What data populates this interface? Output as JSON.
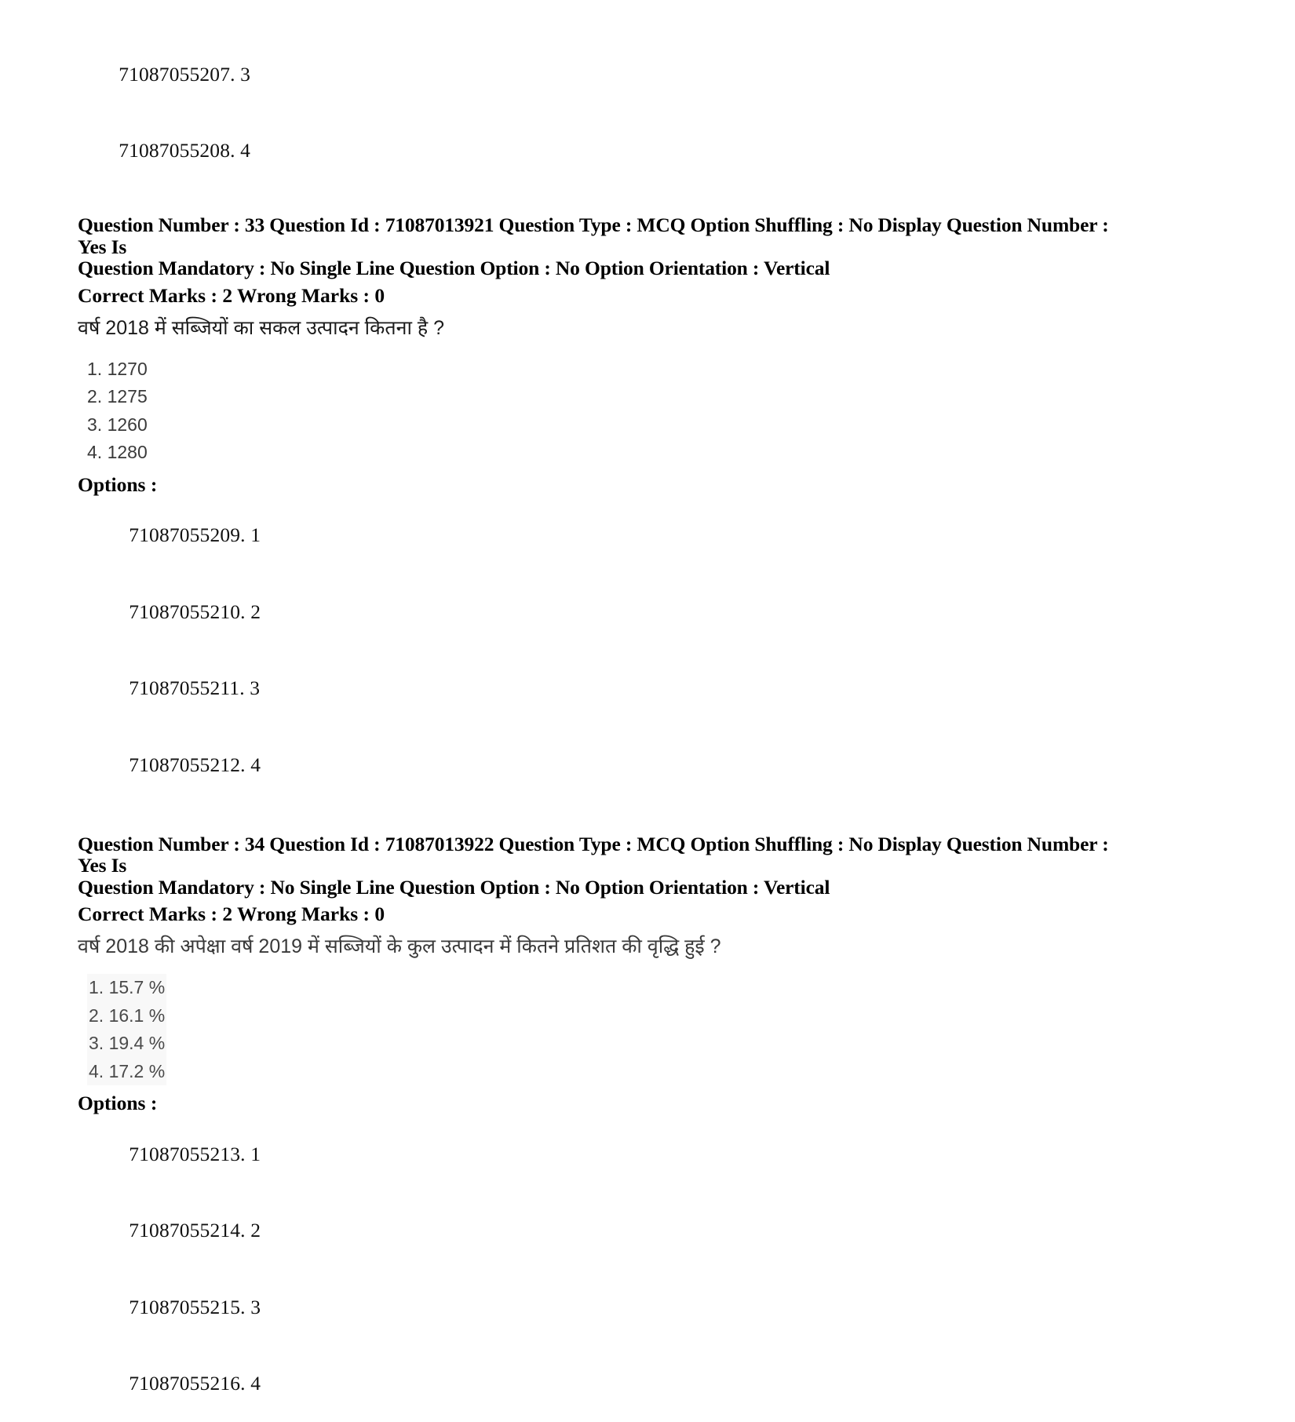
{
  "document": {
    "type": "exam-answer-key-page",
    "language_primary": "English",
    "language_question": "Hindi"
  },
  "top_option_ids": [
    {
      "id": "71087055207",
      "value": "3"
    },
    {
      "id": "71087055208",
      "value": "4"
    }
  ],
  "questions": [
    {
      "header_line_1": "Question Number : 33 Question Id : 71087013921 Question Type : MCQ Option Shuffling : No Display Question Number : Yes Is",
      "header_line_2": "Question Mandatory : No Single Line Question Option : No Option Orientation : Vertical",
      "marks_line": "Correct Marks : 2 Wrong Marks : 0",
      "question_number": "33",
      "question_id": "71087013921",
      "question_type": "MCQ",
      "option_shuffling": "No",
      "display_question_number": "Yes",
      "is_question_mandatory": "No",
      "single_line_question_option": "No",
      "option_orientation": "Vertical",
      "correct_marks": "2",
      "wrong_marks": "0",
      "question_text": "वर्ष 2018 में सब्जियों का सकल उत्पादन कितना है ?",
      "choices": [
        "1. 1270",
        "2. 1275",
        "3. 1260",
        "4. 1280"
      ],
      "options_label": "Options :",
      "option_ids": [
        {
          "id": "71087055209",
          "value": "1"
        },
        {
          "id": "71087055210",
          "value": "2"
        },
        {
          "id": "71087055211",
          "value": "3"
        },
        {
          "id": "71087055212",
          "value": "4"
        }
      ]
    },
    {
      "header_line_1": "Question Number : 34 Question Id : 71087013922 Question Type : MCQ Option Shuffling : No Display Question Number : Yes Is",
      "header_line_2": "Question Mandatory : No Single Line Question Option : No Option Orientation : Vertical",
      "marks_line": "Correct Marks : 2 Wrong Marks : 0",
      "question_number": "34",
      "question_id": "71087013922",
      "question_type": "MCQ",
      "option_shuffling": "No",
      "display_question_number": "Yes",
      "is_question_mandatory": "No",
      "single_line_question_option": "No",
      "option_orientation": "Vertical",
      "correct_marks": "2",
      "wrong_marks": "0",
      "question_text": "वर्ष 2018 की अपेक्षा वर्ष 2019 में सब्जियों के कुल उत्पादन में कितने प्रतिशत की वृद्धि हुई ?",
      "choices": [
        "1. 15.7 %",
        "2. 16.1 %",
        "3. 19.4 %",
        "4. 17.2 %"
      ],
      "options_label": "Options :",
      "option_ids": [
        {
          "id": "71087055213",
          "value": "1"
        },
        {
          "id": "71087055214",
          "value": "2"
        },
        {
          "id": "71087055215",
          "value": "3"
        },
        {
          "id": "71087055216",
          "value": "4"
        }
      ]
    }
  ]
}
